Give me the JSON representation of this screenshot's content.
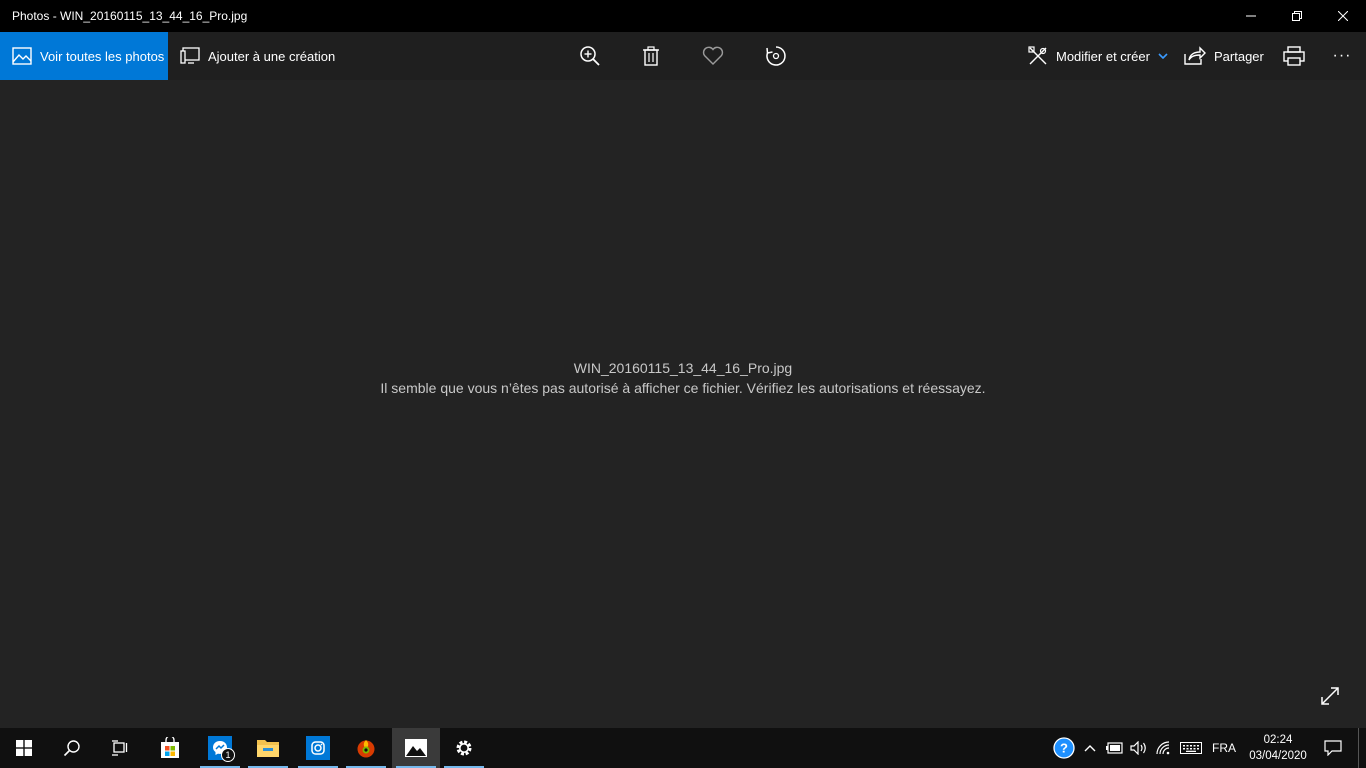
{
  "window": {
    "title": "Photos - WIN_20160115_13_44_16_Pro.jpg"
  },
  "toolbar": {
    "view_all_label": "Voir toutes les photos",
    "add_to_creation_label": "Ajouter à une création",
    "edit_create_label": "Modifier et créer",
    "share_label": "Partager",
    "more_label": "···"
  },
  "content": {
    "file_name": "WIN_20160115_13_44_16_Pro.jpg",
    "error_message": "Il semble que vous n’êtes pas autorisé à afficher ce fichier. Vérifiez les autorisations et réessayez."
  },
  "taskbar": {
    "messenger_badge": "1",
    "language": "FRA",
    "time": "02:24",
    "date": "03/04/2020"
  },
  "colors": {
    "accent": "#0078d7",
    "title_bg": "#000000",
    "content_bg": "#232323",
    "taskbar_bg": "#101010"
  }
}
